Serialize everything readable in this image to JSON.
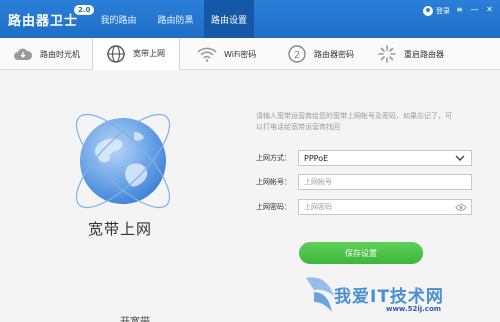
{
  "app": {
    "title": "路由器卫士",
    "version": "2.0"
  },
  "nav": {
    "tabs": [
      "我的路由",
      "路由防黑",
      "路由设置"
    ],
    "active": 2
  },
  "user": {
    "login_label": "登录"
  },
  "window": {
    "menu": "≡",
    "minimize": "—",
    "close": "✕"
  },
  "subtabs": {
    "items": [
      {
        "label": "路由时光机",
        "icon": "cloud-icon"
      },
      {
        "label": "宽带上网",
        "icon": "globe-icon"
      },
      {
        "label": "WiFi密码",
        "icon": "wifi-icon"
      },
      {
        "label": "路由器密码",
        "icon": "key-icon"
      },
      {
        "label": "重启路由器",
        "icon": "restart-icon"
      }
    ],
    "active": 1
  },
  "main": {
    "caption": "宽带上网",
    "description": "请输入宽带运营商给您的宽带上网帐号及密码，如果忘记了，可以打电话给宽带运营商找回",
    "form": {
      "method_label": "上网方式：",
      "method_value": "PPPoE",
      "account_label": "上网帐号：",
      "account_placeholder": "上网帐号",
      "password_label": "上网密码：",
      "password_placeholder": "上网密码"
    },
    "save_label": "保存设置"
  },
  "watermark": {
    "text": "我爱IT技术网",
    "url": "www.52ij.com"
  },
  "footer_partial": "开宽带"
}
